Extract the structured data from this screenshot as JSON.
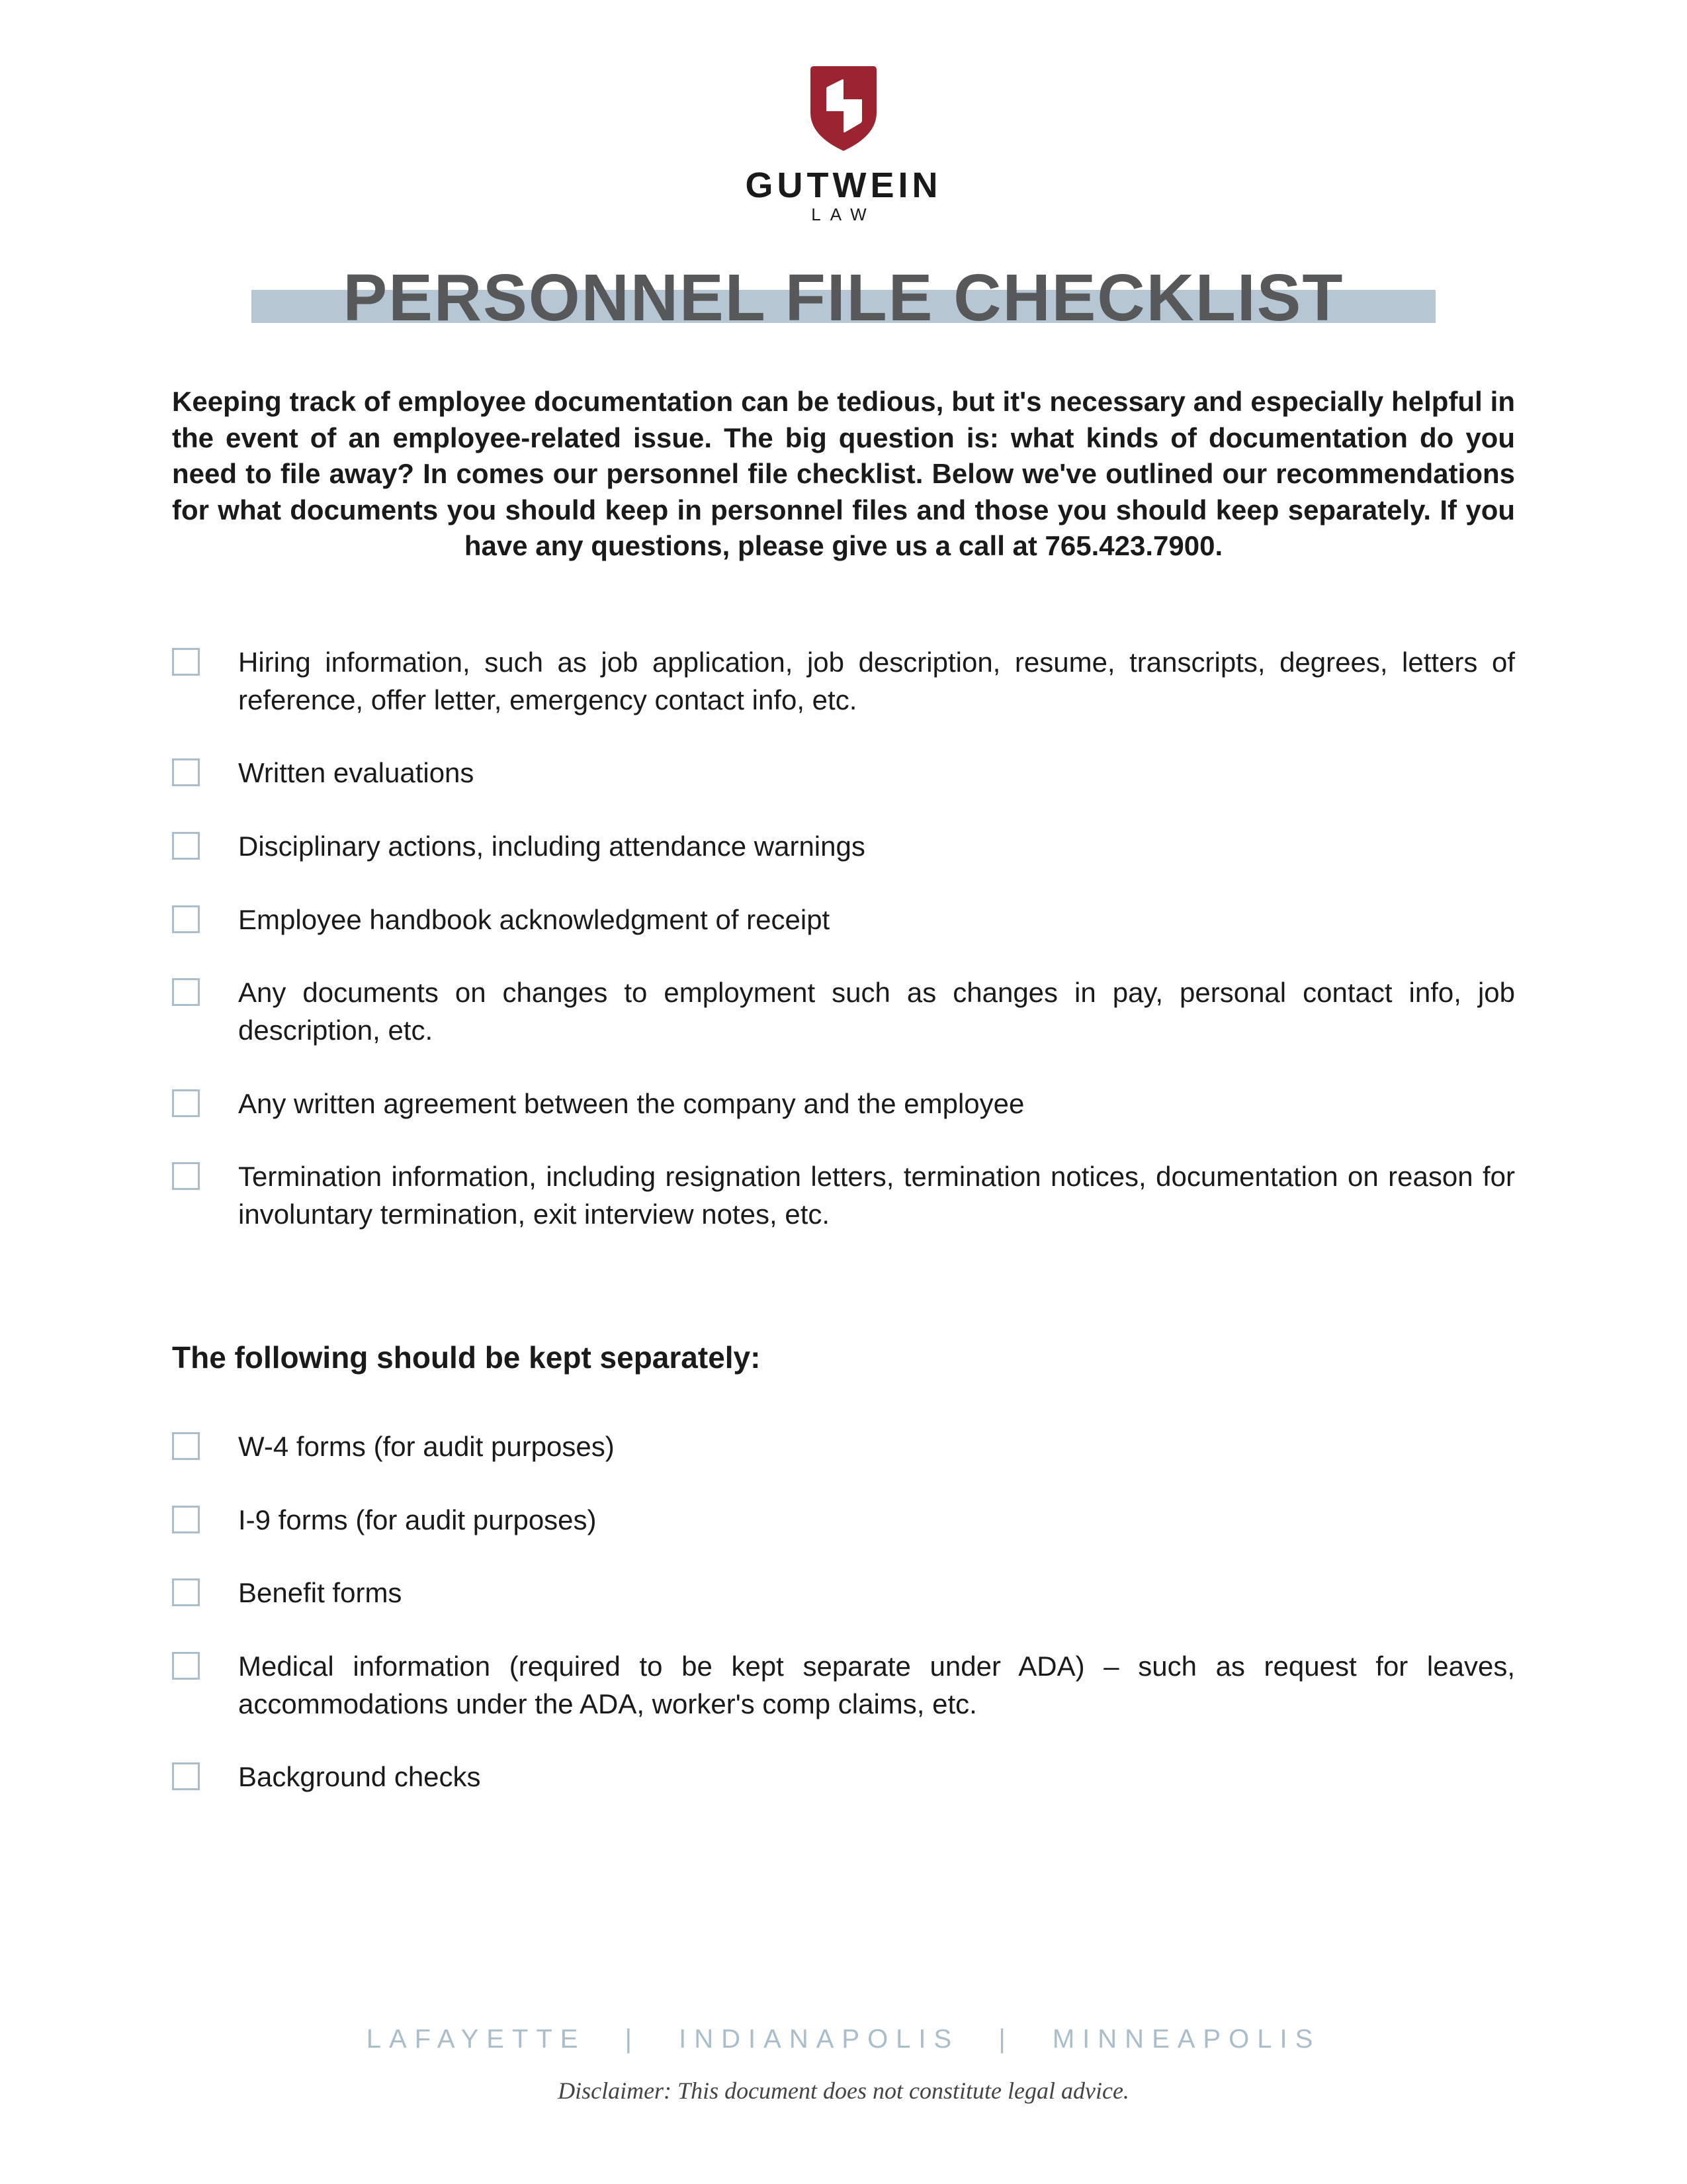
{
  "logo": {
    "brand_main": "GUTWEIN",
    "brand_sub": "LAW"
  },
  "title": "PERSONNEL FILE CHECKLIST",
  "intro": "Keeping track of employee documentation can be tedious, but it's necessary and especially helpful in the event of an employee-related issue. The big question is: what kinds of documentation do you need to file away? In comes our personnel file checklist. Below we've outlined our recommendations for what documents you should keep in personnel files and those you should keep separately. If you have any questions, please give us a call at 765.423.7900.",
  "checklist_main": [
    "Hiring information, such as job application, job description, resume, transcripts, degrees, letters of reference, offer letter, emergency contact info, etc.",
    "Written evaluations",
    "Disciplinary actions, including attendance warnings",
    "Employee handbook acknowledgment of receipt",
    "Any documents on changes to employment such as changes in pay, personal contact info, job description, etc.",
    "Any written agreement between the company and the employee",
    "Termination information, including resignation letters, termination notices, documentation on reason for involuntary termination, exit interview notes, etc."
  ],
  "separate_heading": "The following should be kept separately:",
  "checklist_separate": [
    "W-4 forms (for audit purposes)",
    "I-9 forms (for audit purposes)",
    "Benefit forms",
    "Medical information (required to be kept separate under ADA) – such as request for leaves, accommodations under the ADA, worker's comp claims, etc.",
    "Background checks"
  ],
  "footer": {
    "locations": [
      "LAFAYETTE",
      "INDIANAPOLIS",
      "MINNEAPOLIS"
    ],
    "separator": "|",
    "disclaimer": "Disclaimer: This document does not constitute legal advice."
  }
}
